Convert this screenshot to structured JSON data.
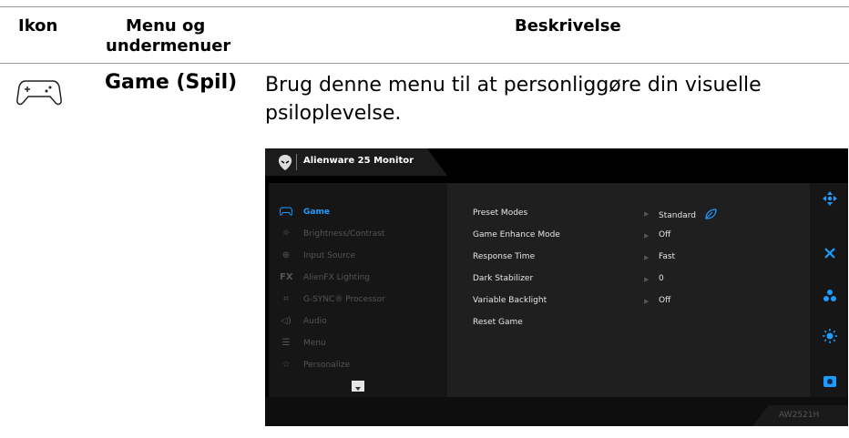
{
  "table": {
    "headers": {
      "icon": "Ikon",
      "menu": "Menu og undermenuer",
      "menu_line1": "Menu og",
      "menu_line2": "undermenuer",
      "description": "Beskrivelse"
    }
  },
  "row": {
    "icon": "gamepad-icon",
    "title": "Game (Spil)",
    "description": "Brug denne menu til at personliggøre din visuelle psiloplevelse."
  },
  "osd": {
    "header_title": "Alienware 25 Monitor",
    "logo_icon": "alienware-logo-icon",
    "model": "AW2521H",
    "menu": [
      {
        "label": "Game",
        "icon": "gamepad-icon",
        "active": true
      },
      {
        "label": "Brightness/Contrast",
        "icon": "brightness-icon",
        "active": false
      },
      {
        "label": "Input Source",
        "icon": "input-source-icon",
        "active": false
      },
      {
        "label": "AlienFX Lighting",
        "icon": "alienfx-icon",
        "active": false
      },
      {
        "label": "G-SYNC® Processor",
        "icon": "processor-icon",
        "active": false
      },
      {
        "label": "Audio",
        "icon": "audio-icon",
        "active": false
      },
      {
        "label": "Menu",
        "icon": "menu-icon",
        "active": false
      },
      {
        "label": "Personalize",
        "icon": "star-icon",
        "active": false
      }
    ],
    "settings": [
      {
        "label": "Preset Modes",
        "value": "Standard",
        "value_icon": "leaf-icon"
      },
      {
        "label": "Game Enhance Mode",
        "value": "Off"
      },
      {
        "label": "Response Time",
        "value": "Fast"
      },
      {
        "label": "Dark Stabilizer",
        "value": "0"
      },
      {
        "label": "Variable Backlight",
        "value": "Off"
      },
      {
        "label": "Reset Game",
        "value": ""
      }
    ],
    "side_buttons": [
      "navigate-icon",
      "close-icon",
      "shortcut-icon",
      "brightness-icon",
      "screen-icon"
    ],
    "accent_color": "#1e9bff"
  }
}
